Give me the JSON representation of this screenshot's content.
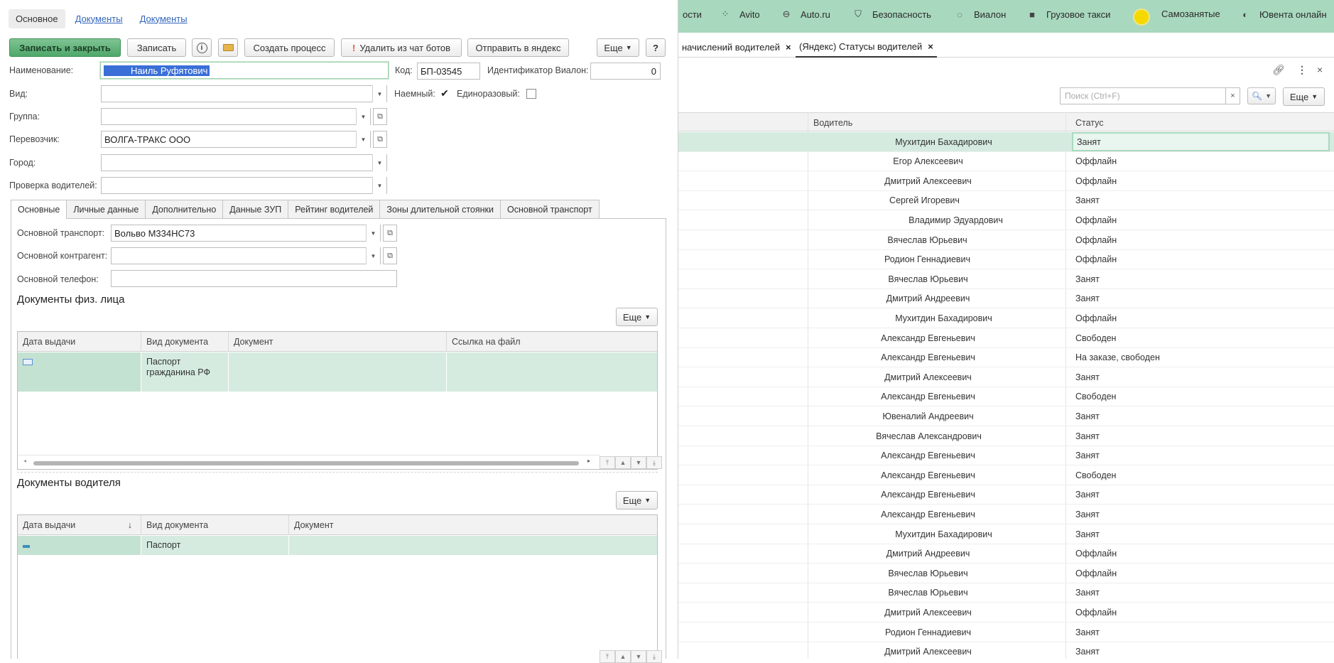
{
  "form": {
    "top_tabs": [
      "Основное",
      "Документы",
      "Документы"
    ],
    "toolbar": {
      "save_close": "Записать и закрыть",
      "save": "Записать",
      "create_process": "Создать процесс",
      "delete_bots": "Удалить из чат ботов",
      "send_yandex": "Отправить в яндекс",
      "more": "Еще",
      "help": "?"
    },
    "fields": {
      "name_label": "Наименование:",
      "name_value": "Наиль Руфятович",
      "code_label": "Код:",
      "code_value": "БП-03545",
      "vialon_label": "Идентификатор Виалон:",
      "vialon_value": "0",
      "kind_label": "Вид:",
      "kind_value": "",
      "hired_label": "Наемный:",
      "hired_checked": true,
      "onetime_label": "Единоразовый:",
      "onetime_checked": false,
      "group_label": "Группа:",
      "group_value": "",
      "carrier_label": "Перевозчик:",
      "carrier_value": "ВОЛГА-ТРАКС ООО",
      "city_label": "Город:",
      "city_value": "",
      "check_label": "Проверка водителей:",
      "check_value": ""
    },
    "inner_tabs": [
      "Основные",
      "Личные данные",
      "Дополнительно",
      "Данные ЗУП",
      "Рейтинг водителей",
      "Зоны длительной стоянки",
      "Основной транспорт"
    ],
    "main": {
      "transport_label": "Основной транспорт:",
      "transport_value": "Вольво М334НС73",
      "contractor_label": "Основной контрагент:",
      "contractor_value": "",
      "phone_label": "Основной телефон:",
      "phone_value": ""
    },
    "phys_docs": {
      "title": "Документы физ. лица",
      "more": "Еще",
      "columns": [
        "Дата выдачи",
        "Вид документа",
        "Документ",
        "Ссылка на файл"
      ],
      "rows": [
        {
          "date": "",
          "kind": "Паспорт гражданина РФ",
          "doc": "",
          "link": ""
        }
      ]
    },
    "driver_docs": {
      "title": "Документы водителя",
      "more": "Еще",
      "columns": [
        "Дата выдачи",
        "Вид документа",
        "Документ"
      ],
      "sort_arrow": "↓",
      "rows": [
        {
          "date": "",
          "kind": "Паспорт",
          "doc": ""
        }
      ]
    }
  },
  "right": {
    "navbar": [
      {
        "label": "ости",
        "icon": ""
      },
      {
        "label": "Avito",
        "icon": "avito-icon"
      },
      {
        "label": "Auto.ru",
        "icon": "car-icon"
      },
      {
        "label": "Безопасность",
        "icon": "shield-icon"
      },
      {
        "label": "Виалон",
        "icon": "vialon-icon"
      },
      {
        "label": "Грузовое такси",
        "icon": "truck-icon"
      },
      {
        "label": "Самозанятые",
        "icon": "sun-icon"
      },
      {
        "label": "Ювента онлайн",
        "icon": "globe-icon"
      }
    ],
    "open_tabs": [
      {
        "label": "начислений водителей",
        "close": "×"
      },
      {
        "label": "(Яндекс) Статусы водителей",
        "close": "×"
      }
    ],
    "search_placeholder": "Поиск (Ctrl+F)",
    "search_clear": "×",
    "more": "Еще",
    "columns": {
      "driver": "Водитель",
      "status": "Статус"
    },
    "rows": [
      {
        "driver": "Мухитдин Бахадирович",
        "status": "Занят"
      },
      {
        "driver": "Егор Алексеевич",
        "status": "Оффлайн"
      },
      {
        "driver": "Дмитрий Алексеевич",
        "status": "Оффлайн"
      },
      {
        "driver": "Сергей Игоревич",
        "status": "Занят"
      },
      {
        "driver": "Владимир Эдуардович",
        "status": "Оффлайн"
      },
      {
        "driver": "Вячеслав Юрьевич",
        "status": "Оффлайн"
      },
      {
        "driver": "Родион Геннадиевич",
        "status": "Оффлайн"
      },
      {
        "driver": "Вячеслав Юрьевич",
        "status": "Занят"
      },
      {
        "driver": "Дмитрий Андреевич",
        "status": "Занят"
      },
      {
        "driver": "Мухитдин Бахадирович",
        "status": "Оффлайн"
      },
      {
        "driver": "Александр Евгеньевич",
        "status": "Свободен"
      },
      {
        "driver": "Александр Евгеньевич",
        "status": "На заказе, свободен"
      },
      {
        "driver": "Дмитрий Алексеевич",
        "status": "Занят"
      },
      {
        "driver": "Александр Евгеньевич",
        "status": "Свободен"
      },
      {
        "driver": "Ювеналий Андреевич",
        "status": "Занят"
      },
      {
        "driver": "Вячеслав Александрович",
        "status": "Занят"
      },
      {
        "driver": "Александр Евгеньевич",
        "status": "Занят"
      },
      {
        "driver": "Александр Евгеньевич",
        "status": "Свободен"
      },
      {
        "driver": "Александр Евгеньевич",
        "status": "Занят"
      },
      {
        "driver": "Александр Евгеньевич",
        "status": "Занят"
      },
      {
        "driver": "Мухитдин Бахадирович",
        "status": "Занят"
      },
      {
        "driver": "Дмитрий Андреевич",
        "status": "Оффлайн"
      },
      {
        "driver": "Вячеслав Юрьевич",
        "status": "Оффлайн"
      },
      {
        "driver": "Вячеслав Юрьевич",
        "status": "Занят"
      },
      {
        "driver": "Дмитрий Алексеевич",
        "status": "Оффлайн"
      },
      {
        "driver": "Родион Геннадиевич",
        "status": "Занят"
      },
      {
        "driver": "Дмитрий Алексеевич",
        "status": "Занят"
      }
    ]
  }
}
